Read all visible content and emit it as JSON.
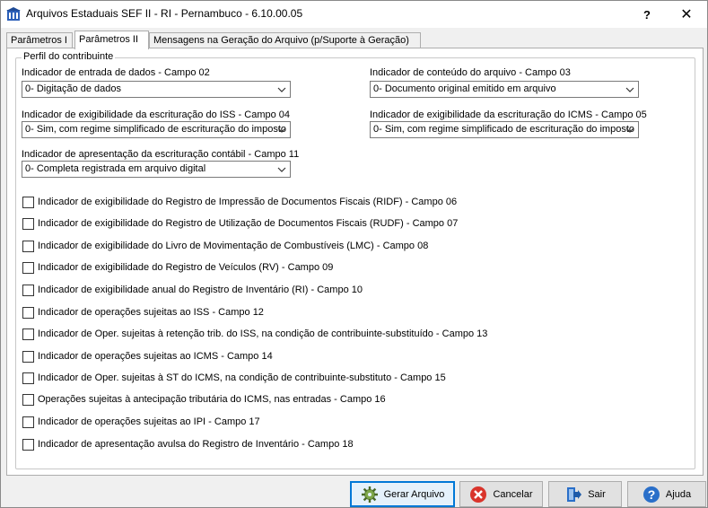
{
  "window": {
    "title": "Arquivos Estaduais SEF II - RI - Pernambuco - 6.10.00.05",
    "help_glyph": "?",
    "close_glyph": "✕"
  },
  "tabs": [
    {
      "label": "Parâmetros I",
      "active": false
    },
    {
      "label": "Parâmetros II",
      "active": true
    },
    {
      "label": "Mensagens na Geração do Arquivo (p/Suporte à Geração)",
      "active": false
    }
  ],
  "group": {
    "legend": "Perfil do contribuinte"
  },
  "fields": {
    "campo02": {
      "label": "Indicador de entrada de dados - Campo 02",
      "value": "0- Digitação de dados"
    },
    "campo03": {
      "label": "Indicador de conteúdo do arquivo - Campo 03",
      "value": "0- Documento original emitido em arquivo"
    },
    "campo04": {
      "label": "Indicador de exigibilidade da escrituração do ISS - Campo 04",
      "value": "0- Sim, com regime simplificado de escrituração do imposto"
    },
    "campo05": {
      "label": "Indicador de exigibilidade da escrituração do ICMS - Campo 05",
      "value": "0- Sim, com regime simplificado de escrituração do imposto"
    },
    "campo11": {
      "label": "Indicador de apresentação da escrituração contábil - Campo 11",
      "value": "0- Completa registrada em arquivo digital"
    }
  },
  "checkboxes": [
    {
      "label": "Indicador de exigibilidade do Registro de Impressão de Documentos Fiscais (RIDF) - Campo 06",
      "checked": false
    },
    {
      "label": "Indicador de exigibilidade do Registro de Utilização de Documentos Fiscais (RUDF) - Campo 07",
      "checked": false
    },
    {
      "label": "Indicador de exigibilidade do Livro de Movimentação de Combustíveis (LMC) - Campo 08",
      "checked": false
    },
    {
      "label": "Indicador de exigibilidade do Registro de Veículos (RV) - Campo 09",
      "checked": false
    },
    {
      "label": "Indicador de exigibilidade anual do Registro de Inventário (RI) - Campo 10",
      "checked": false
    },
    {
      "label": "Indicador de operações sujeitas ao ISS - Campo 12",
      "checked": false
    },
    {
      "label": "Indicador de Oper. sujeitas à retenção trib. do ISS, na condição de contribuinte-substituído - Campo 13",
      "checked": false
    },
    {
      "label": "Indicador de operações sujeitas ao ICMS - Campo 14",
      "checked": false
    },
    {
      "label": "Indicador de Oper. sujeitas à ST do ICMS, na condição de contribuinte-substituto - Campo 15",
      "checked": false
    },
    {
      "label": "Operações sujeitas à antecipação tributária do ICMS, nas entradas - Campo 16",
      "checked": false
    },
    {
      "label": "Indicador de operações sujeitas ao IPI - Campo 17",
      "checked": false
    },
    {
      "label": "Indicador de apresentação avulsa do Registro de Inventário - Campo 18",
      "checked": false
    }
  ],
  "buttons": {
    "gerar": "Gerar Arquivo",
    "cancelar": "Cancelar",
    "sair": "Sair",
    "ajuda": "Ajuda"
  },
  "icons": {
    "app": "building-icon",
    "gerar": "gear-icon",
    "cancelar": "cancel-icon",
    "sair": "exit-door-icon",
    "ajuda": "help-icon"
  },
  "colors": {
    "primary_border": "#0078d7",
    "cancel_red": "#d9342b",
    "help_blue": "#2a6fc9"
  }
}
